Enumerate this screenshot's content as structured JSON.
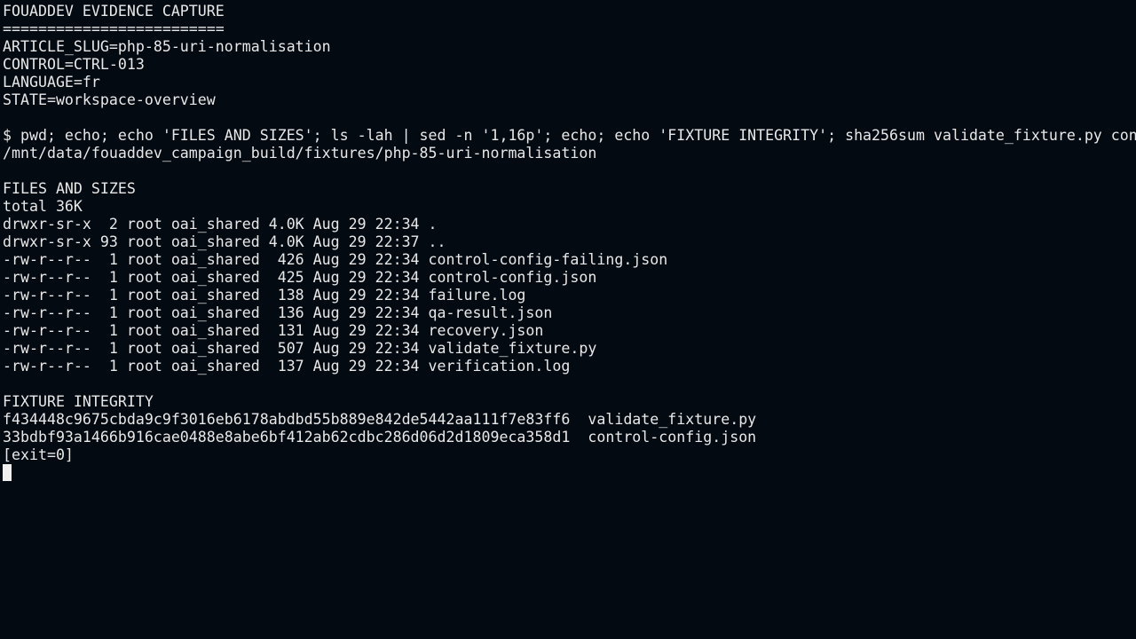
{
  "terminal": {
    "header": {
      "title": "FOUADDEV EVIDENCE CAPTURE",
      "rule": "=========================",
      "article_slug": "ARTICLE_SLUG=php-85-uri-normalisation",
      "control": "CONTROL=CTRL-013",
      "language": "LANGUAGE=fr",
      "state": "STATE=workspace-overview"
    },
    "command": "$ pwd; echo; echo 'FILES AND SIZES'; ls -lah | sed -n '1,16p'; echo; echo 'FIXTURE INTEGRITY'; sha256sum validate_fixture.py con",
    "cwd": "/mnt/data/fouaddev_campaign_build/fixtures/php-85-uri-normalisation",
    "files_section": {
      "heading": "FILES AND SIZES",
      "total": "total 36K",
      "entries": [
        "drwxr-sr-x  2 root oai_shared 4.0K Aug 29 22:34 .",
        "drwxr-sr-x 93 root oai_shared 4.0K Aug 29 22:37 ..",
        "-rw-r--r--  1 root oai_shared  426 Aug 29 22:34 control-config-failing.json",
        "-rw-r--r--  1 root oai_shared  425 Aug 29 22:34 control-config.json",
        "-rw-r--r--  1 root oai_shared  138 Aug 29 22:34 failure.log",
        "-rw-r--r--  1 root oai_shared  136 Aug 29 22:34 qa-result.json",
        "-rw-r--r--  1 root oai_shared  131 Aug 29 22:34 recovery.json",
        "-rw-r--r--  1 root oai_shared  507 Aug 29 22:34 validate_fixture.py",
        "-rw-r--r--  1 root oai_shared  137 Aug 29 22:34 verification.log"
      ]
    },
    "integrity_section": {
      "heading": "FIXTURE INTEGRITY",
      "hashes": [
        "f434448c9675cbda9c9f3016eb6178abdbd55b889e842de5442aa111f7e83ff6  validate_fixture.py",
        "33bdbf93a1466b916cae0488e8abe6bf412ab62cdbc286d06d2d1809eca358d1  control-config.json"
      ]
    },
    "exit_status": "[exit=0]"
  },
  "colors": {
    "background": "#040a12",
    "foreground": "#e8e8e8",
    "cursor": "#f0f0f0"
  }
}
